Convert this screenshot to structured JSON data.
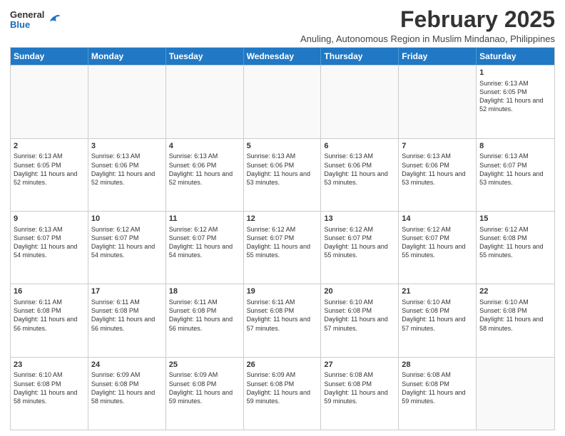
{
  "logo": {
    "general": "General",
    "blue": "Blue"
  },
  "title": {
    "month_year": "February 2025",
    "location": "Anuling, Autonomous Region in Muslim Mindanao, Philippines"
  },
  "weekdays": [
    "Sunday",
    "Monday",
    "Tuesday",
    "Wednesday",
    "Thursday",
    "Friday",
    "Saturday"
  ],
  "weeks": [
    [
      {
        "day": "",
        "sunrise": "",
        "sunset": "",
        "daylight": ""
      },
      {
        "day": "",
        "sunrise": "",
        "sunset": "",
        "daylight": ""
      },
      {
        "day": "",
        "sunrise": "",
        "sunset": "",
        "daylight": ""
      },
      {
        "day": "",
        "sunrise": "",
        "sunset": "",
        "daylight": ""
      },
      {
        "day": "",
        "sunrise": "",
        "sunset": "",
        "daylight": ""
      },
      {
        "day": "",
        "sunrise": "",
        "sunset": "",
        "daylight": ""
      },
      {
        "day": "1",
        "sunrise": "Sunrise: 6:13 AM",
        "sunset": "Sunset: 6:05 PM",
        "daylight": "Daylight: 11 hours and 52 minutes."
      }
    ],
    [
      {
        "day": "2",
        "sunrise": "Sunrise: 6:13 AM",
        "sunset": "Sunset: 6:05 PM",
        "daylight": "Daylight: 11 hours and 52 minutes."
      },
      {
        "day": "3",
        "sunrise": "Sunrise: 6:13 AM",
        "sunset": "Sunset: 6:06 PM",
        "daylight": "Daylight: 11 hours and 52 minutes."
      },
      {
        "day": "4",
        "sunrise": "Sunrise: 6:13 AM",
        "sunset": "Sunset: 6:06 PM",
        "daylight": "Daylight: 11 hours and 52 minutes."
      },
      {
        "day": "5",
        "sunrise": "Sunrise: 6:13 AM",
        "sunset": "Sunset: 6:06 PM",
        "daylight": "Daylight: 11 hours and 53 minutes."
      },
      {
        "day": "6",
        "sunrise": "Sunrise: 6:13 AM",
        "sunset": "Sunset: 6:06 PM",
        "daylight": "Daylight: 11 hours and 53 minutes."
      },
      {
        "day": "7",
        "sunrise": "Sunrise: 6:13 AM",
        "sunset": "Sunset: 6:06 PM",
        "daylight": "Daylight: 11 hours and 53 minutes."
      },
      {
        "day": "8",
        "sunrise": "Sunrise: 6:13 AM",
        "sunset": "Sunset: 6:07 PM",
        "daylight": "Daylight: 11 hours and 53 minutes."
      }
    ],
    [
      {
        "day": "9",
        "sunrise": "Sunrise: 6:13 AM",
        "sunset": "Sunset: 6:07 PM",
        "daylight": "Daylight: 11 hours and 54 minutes."
      },
      {
        "day": "10",
        "sunrise": "Sunrise: 6:12 AM",
        "sunset": "Sunset: 6:07 PM",
        "daylight": "Daylight: 11 hours and 54 minutes."
      },
      {
        "day": "11",
        "sunrise": "Sunrise: 6:12 AM",
        "sunset": "Sunset: 6:07 PM",
        "daylight": "Daylight: 11 hours and 54 minutes."
      },
      {
        "day": "12",
        "sunrise": "Sunrise: 6:12 AM",
        "sunset": "Sunset: 6:07 PM",
        "daylight": "Daylight: 11 hours and 55 minutes."
      },
      {
        "day": "13",
        "sunrise": "Sunrise: 6:12 AM",
        "sunset": "Sunset: 6:07 PM",
        "daylight": "Daylight: 11 hours and 55 minutes."
      },
      {
        "day": "14",
        "sunrise": "Sunrise: 6:12 AM",
        "sunset": "Sunset: 6:07 PM",
        "daylight": "Daylight: 11 hours and 55 minutes."
      },
      {
        "day": "15",
        "sunrise": "Sunrise: 6:12 AM",
        "sunset": "Sunset: 6:08 PM",
        "daylight": "Daylight: 11 hours and 55 minutes."
      }
    ],
    [
      {
        "day": "16",
        "sunrise": "Sunrise: 6:11 AM",
        "sunset": "Sunset: 6:08 PM",
        "daylight": "Daylight: 11 hours and 56 minutes."
      },
      {
        "day": "17",
        "sunrise": "Sunrise: 6:11 AM",
        "sunset": "Sunset: 6:08 PM",
        "daylight": "Daylight: 11 hours and 56 minutes."
      },
      {
        "day": "18",
        "sunrise": "Sunrise: 6:11 AM",
        "sunset": "Sunset: 6:08 PM",
        "daylight": "Daylight: 11 hours and 56 minutes."
      },
      {
        "day": "19",
        "sunrise": "Sunrise: 6:11 AM",
        "sunset": "Sunset: 6:08 PM",
        "daylight": "Daylight: 11 hours and 57 minutes."
      },
      {
        "day": "20",
        "sunrise": "Sunrise: 6:10 AM",
        "sunset": "Sunset: 6:08 PM",
        "daylight": "Daylight: 11 hours and 57 minutes."
      },
      {
        "day": "21",
        "sunrise": "Sunrise: 6:10 AM",
        "sunset": "Sunset: 6:08 PM",
        "daylight": "Daylight: 11 hours and 57 minutes."
      },
      {
        "day": "22",
        "sunrise": "Sunrise: 6:10 AM",
        "sunset": "Sunset: 6:08 PM",
        "daylight": "Daylight: 11 hours and 58 minutes."
      }
    ],
    [
      {
        "day": "23",
        "sunrise": "Sunrise: 6:10 AM",
        "sunset": "Sunset: 6:08 PM",
        "daylight": "Daylight: 11 hours and 58 minutes."
      },
      {
        "day": "24",
        "sunrise": "Sunrise: 6:09 AM",
        "sunset": "Sunset: 6:08 PM",
        "daylight": "Daylight: 11 hours and 58 minutes."
      },
      {
        "day": "25",
        "sunrise": "Sunrise: 6:09 AM",
        "sunset": "Sunset: 6:08 PM",
        "daylight": "Daylight: 11 hours and 59 minutes."
      },
      {
        "day": "26",
        "sunrise": "Sunrise: 6:09 AM",
        "sunset": "Sunset: 6:08 PM",
        "daylight": "Daylight: 11 hours and 59 minutes."
      },
      {
        "day": "27",
        "sunrise": "Sunrise: 6:08 AM",
        "sunset": "Sunset: 6:08 PM",
        "daylight": "Daylight: 11 hours and 59 minutes."
      },
      {
        "day": "28",
        "sunrise": "Sunrise: 6:08 AM",
        "sunset": "Sunset: 6:08 PM",
        "daylight": "Daylight: 11 hours and 59 minutes."
      },
      {
        "day": "",
        "sunrise": "",
        "sunset": "",
        "daylight": ""
      }
    ]
  ]
}
